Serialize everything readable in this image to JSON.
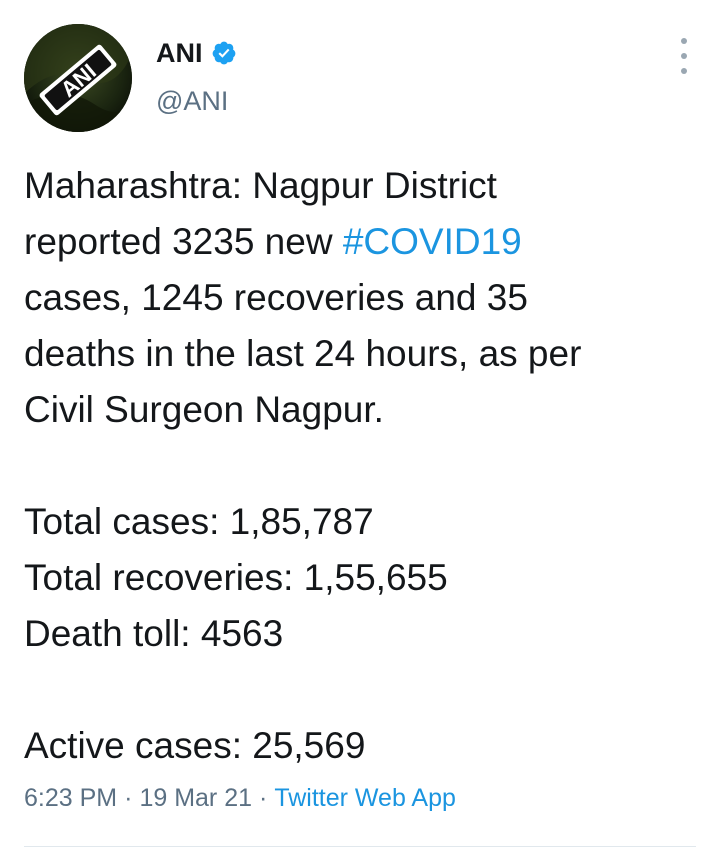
{
  "author": {
    "avatar_text": "ANI",
    "display_name": "ANI",
    "handle": "@ANI",
    "verified": true,
    "verified_color": "#1da1f2"
  },
  "tweet": {
    "line1": "Maharashtra: Nagpur District",
    "line2_prefix": "reported 3235 new ",
    "hashtag": "#COVID19",
    "line3": "cases, 1245 recoveries and 35",
    "line4": "deaths in the last 24 hours, as per",
    "line5": "Civil Surgeon Nagpur.",
    "total_cases": "Total cases: 1,85,787",
    "total_recoveries": "Total recoveries: 1,55,655",
    "death_toll": "Death toll: 4563",
    "active_cases": "Active cases: 25,569"
  },
  "meta": {
    "time": "6:23 PM",
    "separator": "·",
    "date": "19 Mar 21",
    "source": "Twitter Web App"
  },
  "colors": {
    "link": "#1b95e0",
    "secondary_text": "#5b7083"
  },
  "icons": {
    "menu": "more-vertical-icon",
    "verified": "verified-badge-icon"
  }
}
